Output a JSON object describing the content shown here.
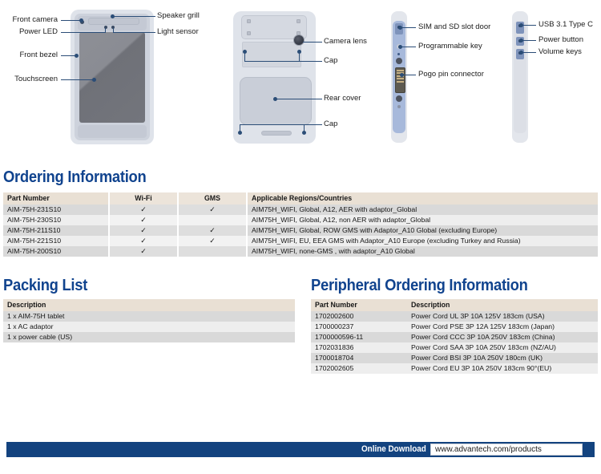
{
  "diagrams": {
    "front": {
      "labels": [
        {
          "id": "front-camera",
          "text": "Front camera"
        },
        {
          "id": "power-led",
          "text": "Power LED"
        },
        {
          "id": "front-bezel",
          "text": "Front bezel"
        },
        {
          "id": "touchscreen",
          "text": "Touchscreen"
        },
        {
          "id": "speaker-grill",
          "text": "Speaker grill"
        },
        {
          "id": "light-sensor",
          "text": "Light sensor"
        }
      ]
    },
    "rear": {
      "labels": [
        {
          "id": "camera-lens",
          "text": "Camera lens"
        },
        {
          "id": "cap-top",
          "text": "Cap"
        },
        {
          "id": "rear-cover",
          "text": "Rear cover"
        },
        {
          "id": "cap-bottom",
          "text": "Cap"
        }
      ]
    },
    "left_side": {
      "labels": [
        {
          "id": "sim-sd-slot-door",
          "text": "SIM and SD slot door"
        },
        {
          "id": "programmable-key",
          "text": "Programmable key"
        },
        {
          "id": "pogo-pin-connector",
          "text": "Pogo pin connector"
        }
      ]
    },
    "right_side": {
      "labels": [
        {
          "id": "usb-type-c",
          "text": "USB 3.1 Type C"
        },
        {
          "id": "power-button",
          "text": "Power button"
        },
        {
          "id": "volume-keys",
          "text": "Volume keys"
        }
      ]
    }
  },
  "ordering": {
    "heading": "Ordering Information",
    "columns": [
      "Part Number",
      "Wi-Fi",
      "GMS",
      "Applicable Regions/Countries"
    ],
    "check_glyph": "✓",
    "rows": [
      {
        "part": "AIM-75H-231S10",
        "wifi": true,
        "gms": true,
        "regions": "AIM75H_WIFI, Global, A12, AER with adaptor_Global"
      },
      {
        "part": "AIM-75H-230S10",
        "wifi": true,
        "gms": false,
        "regions": "AIM75H_WIFI, Global, A12, non AER with adaptor_Global"
      },
      {
        "part": "AIM-75H-211S10",
        "wifi": true,
        "gms": true,
        "regions": "AIM75H_WIFI, Global, ROW GMS with Adaptor_A10 Global (excluding Europe)"
      },
      {
        "part": "AIM-75H-221S10",
        "wifi": true,
        "gms": true,
        "regions": "AIM75H_WIFI, EU, EEA GMS with Adaptor_A10 Europe (excluding Turkey and Russia)"
      },
      {
        "part": "AIM-75H-200S10",
        "wifi": true,
        "gms": false,
        "regions": "AIM75H_WIFI, none-GMS , with adaptor_A10 Global"
      }
    ]
  },
  "packing": {
    "heading": "Packing List",
    "columns": [
      "Description"
    ],
    "rows": [
      {
        "description": "1 x AIM-75H tablet"
      },
      {
        "description": "1 x AC adaptor"
      },
      {
        "description": "1 x power cable (US)"
      }
    ]
  },
  "peripheral": {
    "heading": "Peripheral Ordering Information",
    "columns": [
      "Part Number",
      "Description"
    ],
    "rows": [
      {
        "part": "1702002600",
        "description": "Power Cord UL 3P 10A 125V 183cm (USA)"
      },
      {
        "part": "1700000237",
        "description": "Power Cord PSE 3P 12A 125V 183cm (Japan)"
      },
      {
        "part": "1700000596-11",
        "description": "Power Cord CCC 3P 10A 250V 183cm (China)"
      },
      {
        "part": "1702031836",
        "description": "Power Cord SAA 3P 10A 250V 183cm (NZ/AU)"
      },
      {
        "part": "1700018704",
        "description": "Power Cord BSI 3P 10A 250V 180cm (UK)"
      },
      {
        "part": "1702002605",
        "description": "Power Cord EU 3P 10A 250V 183cm 90°(EU)"
      }
    ]
  },
  "footer": {
    "label": "Online Download",
    "url": "www.advantech.com/products"
  },
  "colors": {
    "heading_blue": "#10438e",
    "footer_blue": "#13437f",
    "table_header_beige": "#e9e0d4",
    "row_odd": "#d9d9d9",
    "row_even": "#eeeeee",
    "leader_line": "#2b4d77"
  }
}
